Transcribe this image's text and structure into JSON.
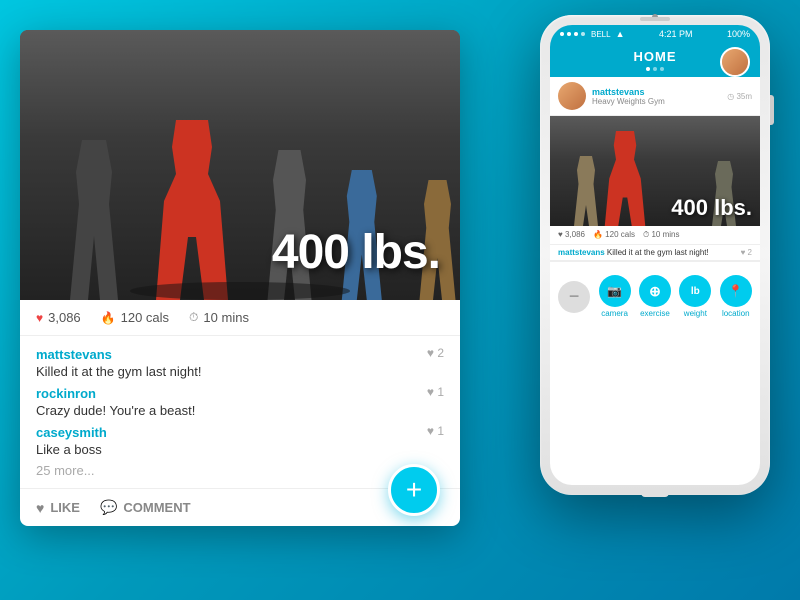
{
  "background": {
    "color_start": "#00c6e0",
    "color_end": "#007aaa"
  },
  "left_card": {
    "weight_label": "400 lbs.",
    "stats": {
      "likes": "3,086",
      "cals": "120 cals",
      "time": "10 mins"
    },
    "comments": [
      {
        "username": "mattstevans",
        "text": "Killed it at the gym last night!",
        "likes": 2
      },
      {
        "username": "rockinron",
        "text": "Crazy dude! You're a beast!",
        "likes": 1
      },
      {
        "username": "caseysmith",
        "text": "Like a boss",
        "likes": 1
      }
    ],
    "more_text": "25 more...",
    "like_btn": "LIKE",
    "comment_btn": "COMMENT",
    "fab_icon": "+"
  },
  "phone": {
    "status_bar": {
      "signal": "○○○○",
      "carrier": "BELL",
      "wifi": "▲",
      "time": "4:21 PM",
      "battery": "100%"
    },
    "nav_title": "HOME",
    "post": {
      "username": "mattstevans",
      "gym": "Heavy Weights Gym",
      "time": "◷ 35m",
      "weight_label": "400 lbs.",
      "likes": "♥ 3,086",
      "cals": "🔥 120 cals",
      "mins": "⏱ 10 mins",
      "comment_username": "mattstevans",
      "comment_text": "Killed it at the gym last night!",
      "comment_likes": "♥ 2"
    },
    "toolbar": {
      "minus_label": "−",
      "camera_label": "camera",
      "exercise_label": "exercise",
      "weight_label": "weight",
      "location_label": "location",
      "camera_icon": "📷",
      "exercise_icon": "⊕",
      "weight_icon": "lb",
      "location_icon": "📍"
    }
  }
}
